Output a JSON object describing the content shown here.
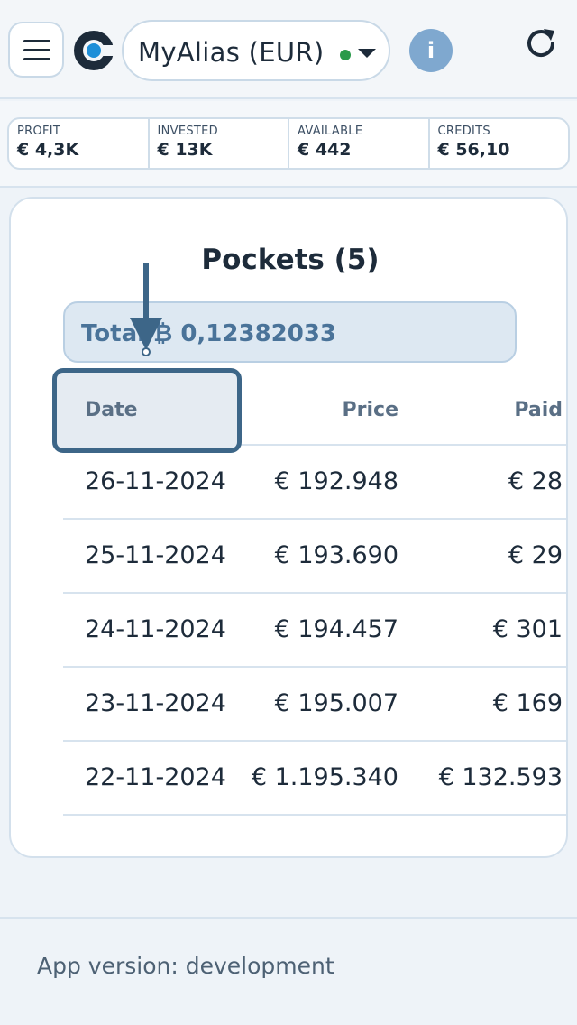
{
  "header": {
    "menu_icon": "hamburger-menu-icon",
    "logo_icon": "brand-logo-icon",
    "account_name": "MyAlias (EUR)",
    "status_color": "#2a9a4a",
    "info_label": "i",
    "refresh_icon": "refresh-icon"
  },
  "stats": [
    {
      "label": "PROFIT",
      "value": "€ 4,3K"
    },
    {
      "label": "INVESTED",
      "value": "€ 13K"
    },
    {
      "label": "AVAILABLE",
      "value": "€ 442"
    },
    {
      "label": "CREDITS",
      "value": "€ 56,10"
    }
  ],
  "pockets": {
    "title": "Pockets (5)",
    "total": "Total ₿ 0,12382033",
    "columns": {
      "date": "Date",
      "price": "Price",
      "paid": "Paid"
    },
    "rows": [
      {
        "date": "26-11-2024",
        "price": "€ 192.948",
        "paid": "€ 28"
      },
      {
        "date": "25-11-2024",
        "price": "€ 193.690",
        "paid": "€ 29"
      },
      {
        "date": "24-11-2024",
        "price": "€ 194.457",
        "paid": "€ 301"
      },
      {
        "date": "23-11-2024",
        "price": "€ 195.007",
        "paid": "€ 169"
      },
      {
        "date": "22-11-2024",
        "price": "€ 1.195.340",
        "paid": "€ 132.593"
      }
    ]
  },
  "footer": {
    "app_version": "App version: development"
  },
  "colors": {
    "accent": "#3d6688",
    "logo_dark": "#1d2b3a",
    "logo_blue": "#1e8fd8"
  }
}
